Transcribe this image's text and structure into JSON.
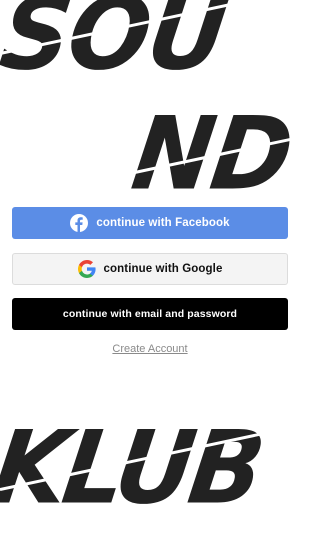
{
  "brand": {
    "word1": "SOU",
    "word2": "ND",
    "word3": "KLUB"
  },
  "auth": {
    "facebook_label": "continue with Facebook",
    "google_label": "continue with Google",
    "email_label": "continue with email and password",
    "create_account_label": "Create Account"
  },
  "icons": {
    "facebook": "facebook-icon",
    "google": "google-icon"
  },
  "colors": {
    "facebook_blue": "#5b8de6",
    "email_black": "#000000",
    "google_bg": "#f4f4f4",
    "logo_text": "#222222"
  }
}
